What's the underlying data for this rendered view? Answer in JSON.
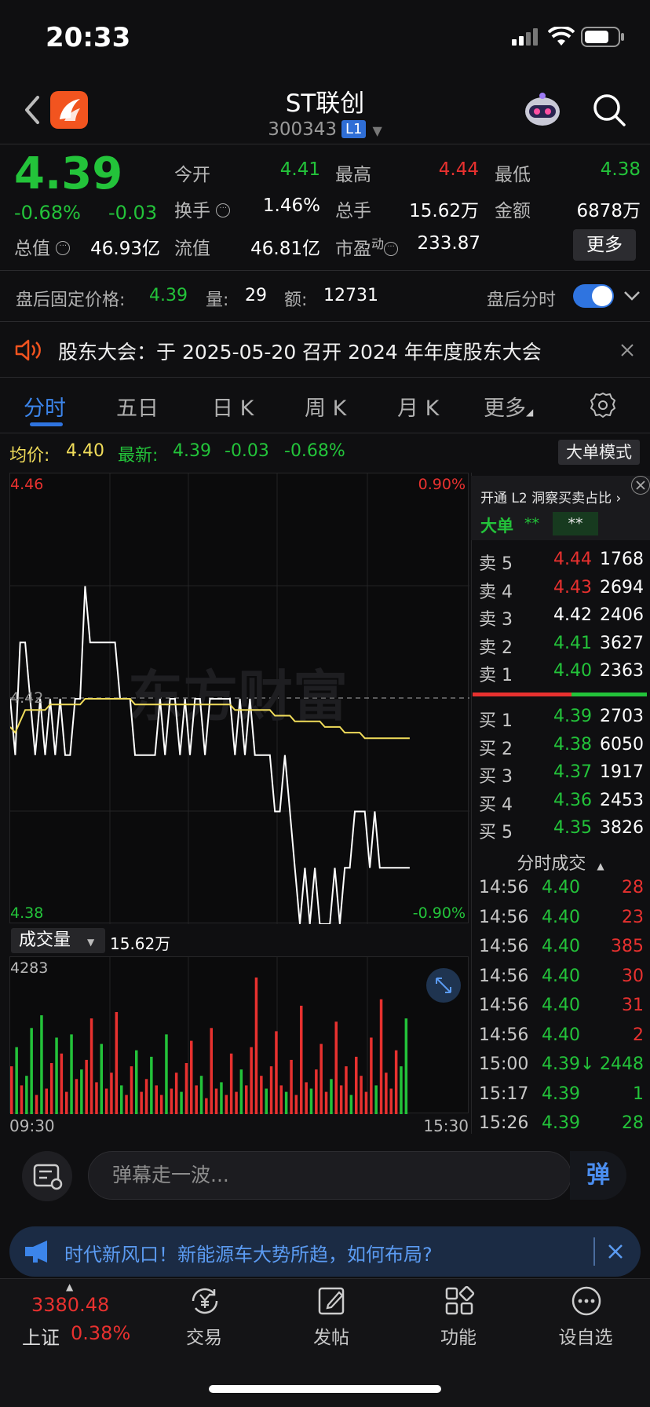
{
  "status_bar": {
    "time": "20:33"
  },
  "header": {
    "stock_name": "ST联创",
    "stock_code": "300343",
    "level_badge": "L1"
  },
  "quote": {
    "last_price": "4.39",
    "change_pct": "-0.68%",
    "change_abs": "-0.03",
    "open_label": "今开",
    "open": "4.41",
    "high_label": "最高",
    "high": "4.44",
    "low_label": "最低",
    "low": "4.38",
    "turnover_label": "换手",
    "turnover": "1.46%",
    "volume_label": "总手",
    "volume": "15.62万",
    "amount_label": "金额",
    "amount": "6878万",
    "mktcap_label": "总值",
    "mktcap": "46.93亿",
    "float_label": "流值",
    "float_cap": "46.81亿",
    "pe_label": "市盈",
    "pe_sup": "动",
    "pe": "233.87",
    "more_label": "更多"
  },
  "after_hours": {
    "price_label": "盘后固定价格:",
    "price": "4.39",
    "vol_label": "量:",
    "vol": "29",
    "amt_label": "额:",
    "amt": "12731",
    "toggle_label": "盘后分时",
    "toggle_on": true
  },
  "announcement": {
    "text": "股东大会：于 2025-05-20 召开 2024 年年度股东大会"
  },
  "tabs": [
    {
      "label": "分时",
      "active": true
    },
    {
      "label": "五日"
    },
    {
      "label": "日 K"
    },
    {
      "label": "周 K"
    },
    {
      "label": "月 K"
    },
    {
      "label": "更多"
    }
  ],
  "avg_row": {
    "avg_label": "均价:",
    "avg": "4.40",
    "latest_label": "最新:",
    "latest": "4.39",
    "latest_change": "-0.03",
    "latest_pct": "-0.68%",
    "mode_button": "大单模式"
  },
  "chart_data": {
    "type": "line",
    "title": "",
    "watermark": "东方财富",
    "y_top_label": "4.46",
    "y_mid_label": "4.42",
    "y_bottom_label": "4.38",
    "pct_top_label": "0.90%",
    "pct_bottom_label": "-0.90%",
    "ylim": [
      4.38,
      4.46
    ],
    "prev_close": 4.42,
    "x_start": "09:30",
    "x_end": "15:30",
    "series": [
      {
        "values": [
          4.42,
          4.41,
          4.43,
          4.43,
          4.42,
          4.41,
          4.42,
          4.41,
          4.42,
          4.41,
          4.42,
          4.41,
          4.41,
          4.42,
          4.42,
          4.44,
          4.43,
          4.43,
          4.43,
          4.43,
          4.43,
          4.43,
          4.42,
          4.42,
          4.42,
          4.41,
          4.41,
          4.41,
          4.41,
          4.41,
          4.42,
          4.41,
          4.42,
          4.42,
          4.41,
          4.42,
          4.41,
          4.42,
          4.42,
          4.41,
          4.42,
          4.42,
          4.42,
          4.42,
          4.42,
          4.41,
          4.42,
          4.41,
          4.42,
          4.41,
          4.41,
          4.41,
          4.41,
          4.4,
          4.4,
          4.41,
          4.4,
          4.39,
          4.38,
          4.39,
          4.38,
          4.39,
          4.38,
          4.38,
          4.38,
          4.39,
          4.38,
          4.39,
          4.39,
          4.4,
          4.4,
          4.4,
          4.39,
          4.4,
          4.39,
          4.39,
          4.39,
          4.39,
          4.39,
          4.39,
          4.39
        ]
      },
      {
        "values": [
          4.415,
          4.414,
          4.416,
          4.418,
          4.418,
          4.418,
          4.418,
          4.418,
          4.419,
          4.419,
          4.419,
          4.419,
          4.419,
          4.419,
          4.419,
          4.42,
          4.42,
          4.42,
          4.42,
          4.42,
          4.42,
          4.42,
          4.42,
          4.42,
          4.42,
          4.419,
          4.419,
          4.419,
          4.419,
          4.419,
          4.419,
          4.419,
          4.419,
          4.419,
          4.419,
          4.419,
          4.419,
          4.419,
          4.419,
          4.419,
          4.419,
          4.419,
          4.419,
          4.419,
          4.419,
          4.418,
          4.418,
          4.418,
          4.418,
          4.418,
          4.418,
          4.418,
          4.418,
          4.417,
          4.417,
          4.417,
          4.417,
          4.416,
          4.416,
          4.416,
          4.416,
          4.416,
          4.416,
          4.415,
          4.415,
          4.415,
          4.415,
          4.414,
          4.414,
          4.414,
          4.414,
          4.413,
          4.413,
          4.413,
          4.413,
          4.413,
          4.413,
          4.413,
          4.413,
          4.413,
          4.413
        ]
      }
    ],
    "volume": {
      "selector_label": "成交量",
      "total": "15.62万",
      "max_label": "4283",
      "max": 4283,
      "bars": [
        {
          "v": 1500,
          "c": "r"
        },
        {
          "v": 2100,
          "c": "g"
        },
        {
          "v": 900,
          "c": "r"
        },
        {
          "v": 1200,
          "c": "g"
        },
        {
          "v": 2700,
          "c": "g"
        },
        {
          "v": 600,
          "c": "r"
        },
        {
          "v": 3100,
          "c": "g"
        },
        {
          "v": 800,
          "c": "r"
        },
        {
          "v": 1600,
          "c": "r"
        },
        {
          "v": 2400,
          "c": "g"
        },
        {
          "v": 1900,
          "c": "r"
        },
        {
          "v": 700,
          "c": "r"
        },
        {
          "v": 2500,
          "c": "g"
        },
        {
          "v": 1100,
          "c": "r"
        },
        {
          "v": 1400,
          "c": "g"
        },
        {
          "v": 1700,
          "c": "r"
        },
        {
          "v": 3000,
          "c": "r"
        },
        {
          "v": 1000,
          "c": "r"
        },
        {
          "v": 2200,
          "c": "g"
        },
        {
          "v": 800,
          "c": "r"
        },
        {
          "v": 1300,
          "c": "r"
        },
        {
          "v": 3200,
          "c": "r"
        },
        {
          "v": 900,
          "c": "g"
        },
        {
          "v": 600,
          "c": "r"
        },
        {
          "v": 1500,
          "c": "r"
        },
        {
          "v": 2000,
          "c": "g"
        },
        {
          "v": 700,
          "c": "r"
        },
        {
          "v": 1100,
          "c": "r"
        },
        {
          "v": 1800,
          "c": "g"
        },
        {
          "v": 900,
          "c": "r"
        },
        {
          "v": 600,
          "c": "r"
        },
        {
          "v": 2500,
          "c": "g"
        },
        {
          "v": 800,
          "c": "r"
        },
        {
          "v": 1300,
          "c": "r"
        },
        {
          "v": 700,
          "c": "g"
        },
        {
          "v": 1600,
          "c": "r"
        },
        {
          "v": 2300,
          "c": "r"
        },
        {
          "v": 900,
          "c": "r"
        },
        {
          "v": 1200,
          "c": "g"
        },
        {
          "v": 500,
          "c": "r"
        },
        {
          "v": 2700,
          "c": "r"
        },
        {
          "v": 800,
          "c": "r"
        },
        {
          "v": 1000,
          "c": "g"
        },
        {
          "v": 600,
          "c": "r"
        },
        {
          "v": 1900,
          "c": "r"
        },
        {
          "v": 700,
          "c": "r"
        },
        {
          "v": 1400,
          "c": "g"
        },
        {
          "v": 900,
          "c": "r"
        },
        {
          "v": 2100,
          "c": "r"
        },
        {
          "v": 4283,
          "c": "r"
        },
        {
          "v": 1200,
          "c": "r"
        },
        {
          "v": 800,
          "c": "g"
        },
        {
          "v": 1500,
          "c": "r"
        },
        {
          "v": 2600,
          "c": "r"
        },
        {
          "v": 900,
          "c": "r"
        },
        {
          "v": 700,
          "c": "g"
        },
        {
          "v": 1700,
          "c": "r"
        },
        {
          "v": 600,
          "c": "r"
        },
        {
          "v": 3400,
          "c": "r"
        },
        {
          "v": 1000,
          "c": "r"
        },
        {
          "v": 800,
          "c": "g"
        },
        {
          "v": 1400,
          "c": "r"
        },
        {
          "v": 2200,
          "c": "r"
        },
        {
          "v": 700,
          "c": "r"
        },
        {
          "v": 1100,
          "c": "g"
        },
        {
          "v": 2900,
          "c": "r"
        },
        {
          "v": 900,
          "c": "r"
        },
        {
          "v": 1500,
          "c": "r"
        },
        {
          "v": 600,
          "c": "g"
        },
        {
          "v": 1800,
          "c": "r"
        },
        {
          "v": 1200,
          "c": "r"
        },
        {
          "v": 700,
          "c": "r"
        },
        {
          "v": 2400,
          "c": "r"
        },
        {
          "v": 900,
          "c": "g"
        },
        {
          "v": 3600,
          "c": "r"
        },
        {
          "v": 1300,
          "c": "r"
        },
        {
          "v": 800,
          "c": "r"
        },
        {
          "v": 2000,
          "c": "r"
        },
        {
          "v": 1500,
          "c": "g"
        },
        {
          "v": 3000,
          "c": "g"
        }
      ]
    }
  },
  "order_book": {
    "l2_promo": "开通 L2 洞察买卖占比",
    "big_order_label": "大单",
    "big_order_buy": "**",
    "big_order_sell": "**",
    "asks": [
      {
        "label": "卖 5",
        "price": "4.44",
        "vol": "1768",
        "color": "red"
      },
      {
        "label": "卖 4",
        "price": "4.43",
        "vol": "2694",
        "color": "red"
      },
      {
        "label": "卖 3",
        "price": "4.42",
        "vol": "2406",
        "color": "white"
      },
      {
        "label": "卖 2",
        "price": "4.41",
        "vol": "3627",
        "color": "green"
      },
      {
        "label": "卖 1",
        "price": "4.40",
        "vol": "2363",
        "color": "green"
      }
    ],
    "bids": [
      {
        "label": "买 1",
        "price": "4.39",
        "vol": "2703",
        "color": "green"
      },
      {
        "label": "买 2",
        "price": "4.38",
        "vol": "6050",
        "color": "green"
      },
      {
        "label": "买 3",
        "price": "4.37",
        "vol": "1917",
        "color": "green"
      },
      {
        "label": "买 4",
        "price": "4.36",
        "vol": "2453",
        "color": "green"
      },
      {
        "label": "买 5",
        "price": "4.35",
        "vol": "3826",
        "color": "green"
      }
    ],
    "ticks_title": "分时成交",
    "ticks": [
      {
        "time": "14:56",
        "price": "4.40",
        "vol": "28",
        "color": "red"
      },
      {
        "time": "14:56",
        "price": "4.40",
        "vol": "23",
        "color": "red"
      },
      {
        "time": "14:56",
        "price": "4.40",
        "vol": "385",
        "color": "red"
      },
      {
        "time": "14:56",
        "price": "4.40",
        "vol": "30",
        "color": "red"
      },
      {
        "time": "14:56",
        "price": "4.40",
        "vol": "31",
        "color": "red"
      },
      {
        "time": "14:56",
        "price": "4.40",
        "vol": "2",
        "color": "red"
      },
      {
        "time": "15:00",
        "price": "4.39↓",
        "vol": "2448",
        "color": "green"
      },
      {
        "time": "15:17",
        "price": "4.39",
        "vol": "1",
        "color": "green"
      },
      {
        "time": "15:26",
        "price": "4.39",
        "vol": "28",
        "color": "green"
      }
    ]
  },
  "danmaku": {
    "placeholder": "弹幕走一波...",
    "send_label": "弹"
  },
  "ad": {
    "text": "时代新风口！新能源车大势所趋，如何布局?"
  },
  "bottom_bar": {
    "index_value": "3380.48",
    "index_name": "上证",
    "index_pct": "0.38%",
    "items": [
      {
        "label": "交易"
      },
      {
        "label": "发帖"
      },
      {
        "label": "功能"
      },
      {
        "label": "设自选"
      }
    ]
  },
  "colors": {
    "red": "#e8312f",
    "green": "#23c33a",
    "yellow": "#f0dc5a",
    "accent": "#2f74e0",
    "bg": "#0f0f11"
  }
}
